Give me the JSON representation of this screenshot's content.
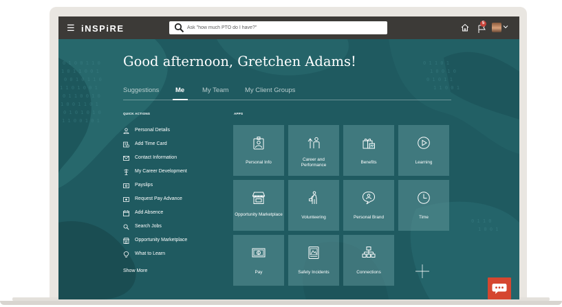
{
  "header": {
    "logo": "iNSPiRE",
    "search_placeholder": "Ask \"how much PTO do I have?\"",
    "notification_count": "5"
  },
  "greeting": "Good afternoon, Gretchen Adams!",
  "tabs": [
    {
      "label": "Suggestions",
      "active": false
    },
    {
      "label": "Me",
      "active": true
    },
    {
      "label": "My Team",
      "active": false
    },
    {
      "label": "My Client Groups",
      "active": false
    }
  ],
  "quick_actions": {
    "title": "QUICK ACTIONS",
    "items": [
      {
        "label": "Personal Details",
        "icon": "person-icon"
      },
      {
        "label": "Add Time Card",
        "icon": "time-card-icon"
      },
      {
        "label": "Contact Information",
        "icon": "envelope-icon"
      },
      {
        "label": "My Career Development",
        "icon": "career-icon"
      },
      {
        "label": "Payslips",
        "icon": "payslip-icon"
      },
      {
        "label": "Request Pay Advance",
        "icon": "pay-advance-icon"
      },
      {
        "label": "Add Absence",
        "icon": "calendar-icon"
      },
      {
        "label": "Search Jobs",
        "icon": "search-icon"
      },
      {
        "label": "Opportunity Marketplace",
        "icon": "store-icon"
      },
      {
        "label": "What to Learn",
        "icon": "lightbulb-icon"
      }
    ],
    "show_more": "Show More"
  },
  "apps": {
    "title": "APPS",
    "tiles": [
      {
        "label": "Personal Info",
        "icon": "id-badge-icon"
      },
      {
        "label": "Career and Performance",
        "icon": "career-performance-icon"
      },
      {
        "label": "Benefits",
        "icon": "gift-icon"
      },
      {
        "label": "Learning",
        "icon": "play-icon"
      },
      {
        "label": "Opportunity Marketplace",
        "icon": "store-icon"
      },
      {
        "label": "Volunteering",
        "icon": "volunteer-icon"
      },
      {
        "label": "Personal Brand",
        "icon": "speech-person-icon"
      },
      {
        "label": "Time",
        "icon": "clock-icon"
      },
      {
        "label": "Pay",
        "icon": "money-icon"
      },
      {
        "label": "Safety Incidents",
        "icon": "safety-icon"
      },
      {
        "label": "Connections",
        "icon": "org-chart-icon"
      }
    ]
  },
  "colors": {
    "header_bg": "#3c3a37",
    "page_bg": "#1f5a60",
    "tile_bg": "rgba(96,150,154,0.52)",
    "chat_button": "#d5462f",
    "badge": "#c7443a"
  }
}
